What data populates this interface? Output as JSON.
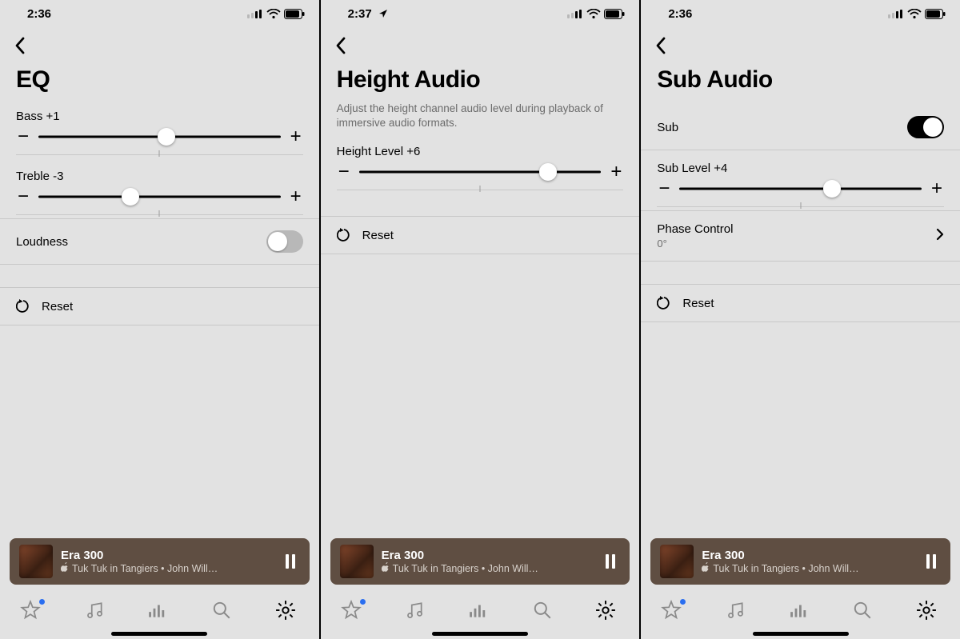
{
  "panes": [
    {
      "status": {
        "time": "2:36",
        "show_location": false
      },
      "title": "EQ",
      "description": null,
      "sliders": [
        {
          "label": "Bass +1",
          "thumb_pct": 53
        },
        {
          "label": "Treble -3",
          "thumb_pct": 38
        }
      ],
      "toggles": [
        {
          "label": "Loudness",
          "on": false,
          "position": "below-sliders"
        }
      ],
      "nav_rows": [],
      "reset_label": "Reset",
      "now_playing": {
        "room": "Era 300",
        "track": "Tuk Tuk in Tangiers • John Will…"
      },
      "active_tab": "settings"
    },
    {
      "status": {
        "time": "2:37",
        "show_location": true
      },
      "title": "Height Audio",
      "description": "Adjust the height channel audio level during playback of immersive audio formats.",
      "sliders": [
        {
          "label": "Height Level +6",
          "thumb_pct": 78
        }
      ],
      "toggles": [],
      "nav_rows": [],
      "reset_label": "Reset",
      "now_playing": {
        "room": "Era 300",
        "track": "Tuk Tuk in Tangiers • John Will…"
      },
      "active_tab": "settings"
    },
    {
      "status": {
        "time": "2:36",
        "show_location": false
      },
      "title": "Sub Audio",
      "description": null,
      "toggles": [
        {
          "label": "Sub",
          "on": true,
          "position": "top"
        }
      ],
      "sliders": [
        {
          "label": "Sub Level +4",
          "thumb_pct": 63
        }
      ],
      "nav_rows": [
        {
          "title": "Phase Control",
          "subtitle": "0°"
        }
      ],
      "reset_label": "Reset",
      "now_playing": {
        "room": "Era 300",
        "track": "Tuk Tuk in Tangiers • John Will…"
      },
      "active_tab": "settings"
    }
  ],
  "glyphs": {
    "minus": "−",
    "plus": "+"
  },
  "tabs": [
    "favorites",
    "music",
    "browse",
    "search",
    "settings"
  ]
}
